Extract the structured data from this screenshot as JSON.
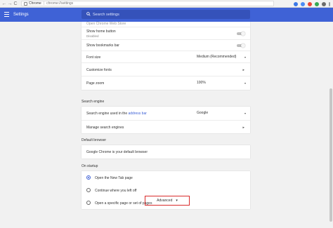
{
  "browser": {
    "back_glyph": "←",
    "forward_glyph": "→",
    "reload_glyph": "C",
    "site_name": "Chrome",
    "url": "chrome://settings",
    "extension_colors": [
      "#3b78e7",
      "#4b8bf4",
      "#ea4335",
      "#34a853",
      "#6c6c6c",
      "#9aa0a6"
    ]
  },
  "header": {
    "title": "Settings",
    "search_placeholder": "Search settings",
    "bg_color": "#3f62d6"
  },
  "appearance": {
    "partial_row_label": "Open Chrome Web Store",
    "show_home_button": {
      "label": "Show home button",
      "sublabel": "Disabled"
    },
    "show_bookmarks_bar": {
      "label": "Show bookmarks bar"
    },
    "font_size": {
      "label": "Font size",
      "value": "Medium (Recommended)"
    },
    "customize_fonts": {
      "label": "Customize fonts"
    },
    "page_zoom": {
      "label": "Page zoom",
      "value": "100%"
    }
  },
  "search_engine": {
    "section_title": "Search engine",
    "engine_row": {
      "label_prefix": "Search engine used in the",
      "link": "address bar",
      "value": "Google"
    },
    "manage_row": {
      "label": "Manage search engines"
    }
  },
  "default_browser": {
    "section_title": "Default browser",
    "status": "Google Chrome is your default browser"
  },
  "on_startup": {
    "section_title": "On startup",
    "options": [
      {
        "label": "Open the New Tab page",
        "checked": true
      },
      {
        "label": "Continue where you left off",
        "checked": false
      },
      {
        "label": "Open a specific page or set of pages",
        "checked": false
      }
    ]
  },
  "advanced": {
    "label": "Advanced",
    "caret": "▾",
    "highlight_color": "#d92b2b"
  },
  "glyphs": {
    "chevron_right": "▸",
    "caret_down": "▾"
  }
}
